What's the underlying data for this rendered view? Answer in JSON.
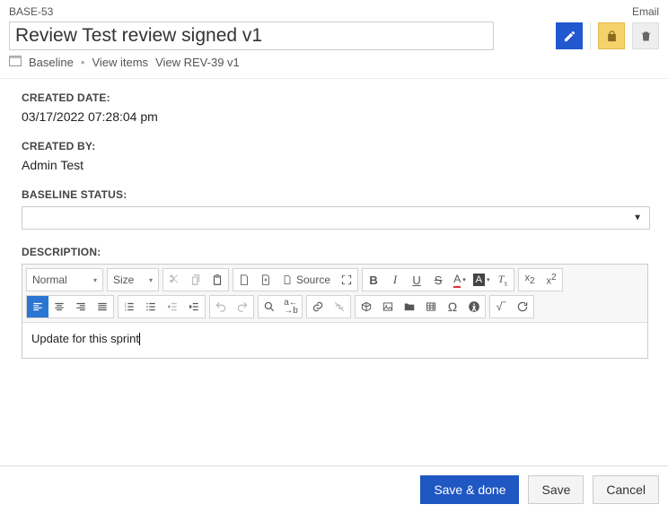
{
  "top": {
    "id": "BASE-53",
    "email": "Email"
  },
  "title": "Review Test review signed v1",
  "subheader": {
    "baseline": "Baseline",
    "view_items": "View items",
    "view_rev": "View REV-39 v1"
  },
  "fields": {
    "created_date_label": "CREATED DATE:",
    "created_date": "03/17/2022 07:28:04 pm",
    "created_by_label": "CREATED BY:",
    "created_by": "Admin Test",
    "status_label": "BASELINE STATUS:",
    "status_value": "",
    "description_label": "DESCRIPTION:"
  },
  "rte": {
    "format": "Normal",
    "size": "Size",
    "source": "Source",
    "content": "Update for this sprint"
  },
  "footer": {
    "save_done": "Save & done",
    "save": "Save",
    "cancel": "Cancel"
  }
}
